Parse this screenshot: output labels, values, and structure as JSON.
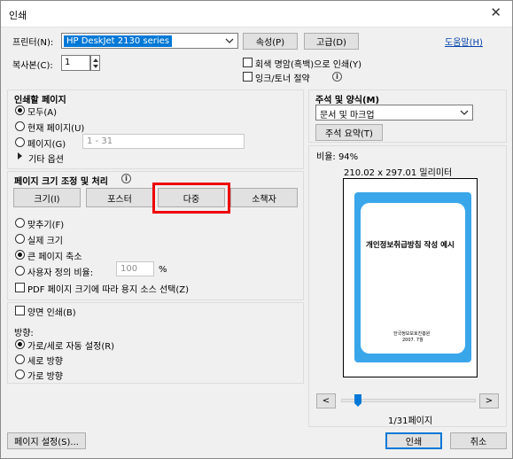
{
  "window": {
    "title": "인쇄",
    "close": "✕"
  },
  "printer": {
    "label": "프린터(N):",
    "selected": "HP DeskJet 2130 series",
    "properties_button": "속성(P)",
    "advanced_button": "고급(D)",
    "help_link": "도움말(H)"
  },
  "copies": {
    "label": "복사본(C):",
    "value": "1"
  },
  "options": {
    "grayscale": "회색 명암(흑백)으로 인쇄(Y)",
    "grayscale_checked": false,
    "save_ink": "잉크/토너 절약",
    "save_ink_checked": false,
    "info_glyph": "i"
  },
  "pages": {
    "title": "인쇄할 페이지",
    "all": "모두(A)",
    "current": "현재 페이지(U)",
    "range": "페이지(G)",
    "range_placeholder": "1 - 31",
    "more": "기타 옵션",
    "selected": "all"
  },
  "sizing": {
    "title": "페이지 크기 조정 및 처리",
    "info_glyph": "i",
    "buttons": [
      "크기(I)",
      "포스터",
      "다중",
      "소책자"
    ],
    "active": "다중",
    "fit": "맞추기(F)",
    "actual": "실제 크기",
    "shrink": "큰 페이지 축소",
    "custom": "사용자 정의 비율:",
    "custom_value": "100",
    "percent": "%",
    "pdf_source": "PDF 페이지 크기에 따라 용지 소스 선택(Z)",
    "selected": "shrink"
  },
  "duplex": {
    "label": "양면 인쇄(B)",
    "checked": false
  },
  "orientation": {
    "title": "방향:",
    "auto": "가로/세로 자동 설정(R)",
    "portrait": "세로 방향",
    "landscape": "가로 방향",
    "selected": "auto"
  },
  "comments": {
    "title": "주석 및 양식(M)",
    "selected": "문서 및 마크업",
    "summary_button": "주석 요약(T)"
  },
  "preview": {
    "scale": "비율: 94%",
    "dimensions": "210.02 x 297.01 밀리미터",
    "doc_title": "개인정보취급방침 작성 예시",
    "doc_org": "한국정보보호진흥원",
    "doc_date": "2007. 7월",
    "page_indicator": "1/31페이지",
    "prev": "<",
    "next": ">",
    "slider_position": 0.0
  },
  "footer": {
    "page_setup": "페이지 설정(S)...",
    "print": "인쇄",
    "cancel": "취소"
  },
  "colors": {
    "accent": "#0078d7",
    "highlight": "#ee0000",
    "cover": "#3aa6ea"
  }
}
